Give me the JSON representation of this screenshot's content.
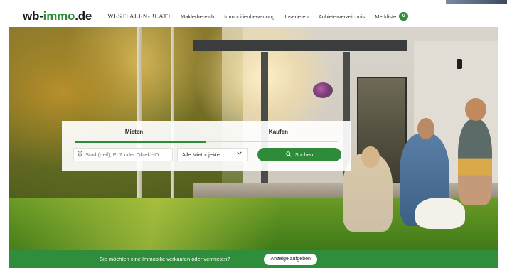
{
  "header": {
    "logo_left": "wb-",
    "logo_accent": "immo",
    "logo_right": ".de",
    "newspaper": "WESTFALEN-BLATT",
    "nav": [
      "Maklerbereich",
      "Immobilienbewertung",
      "Inserieren",
      "Anbieterverzeichnis"
    ],
    "merkliste_label": "Merkliste",
    "merkliste_count": "0"
  },
  "search": {
    "tabs": [
      "Mieten",
      "Kaufen"
    ],
    "active_tab": "Mieten",
    "location_placeholder": "Stadt(-teil), PLZ oder Objekt-ID",
    "type_selected": "Alle Mietobjekte",
    "submit_label": "Suchen"
  },
  "banner": {
    "text": "Sie möchten eine Immobilie verkaufen oder vermieten?",
    "button": "Anzeige aufgeben"
  },
  "colors": {
    "accent": "#2e8b3a",
    "banner": "#2f8d3c"
  },
  "icons": {
    "location": "map-pin-icon",
    "search": "search-icon",
    "dropdown": "chevron-down-icon"
  }
}
